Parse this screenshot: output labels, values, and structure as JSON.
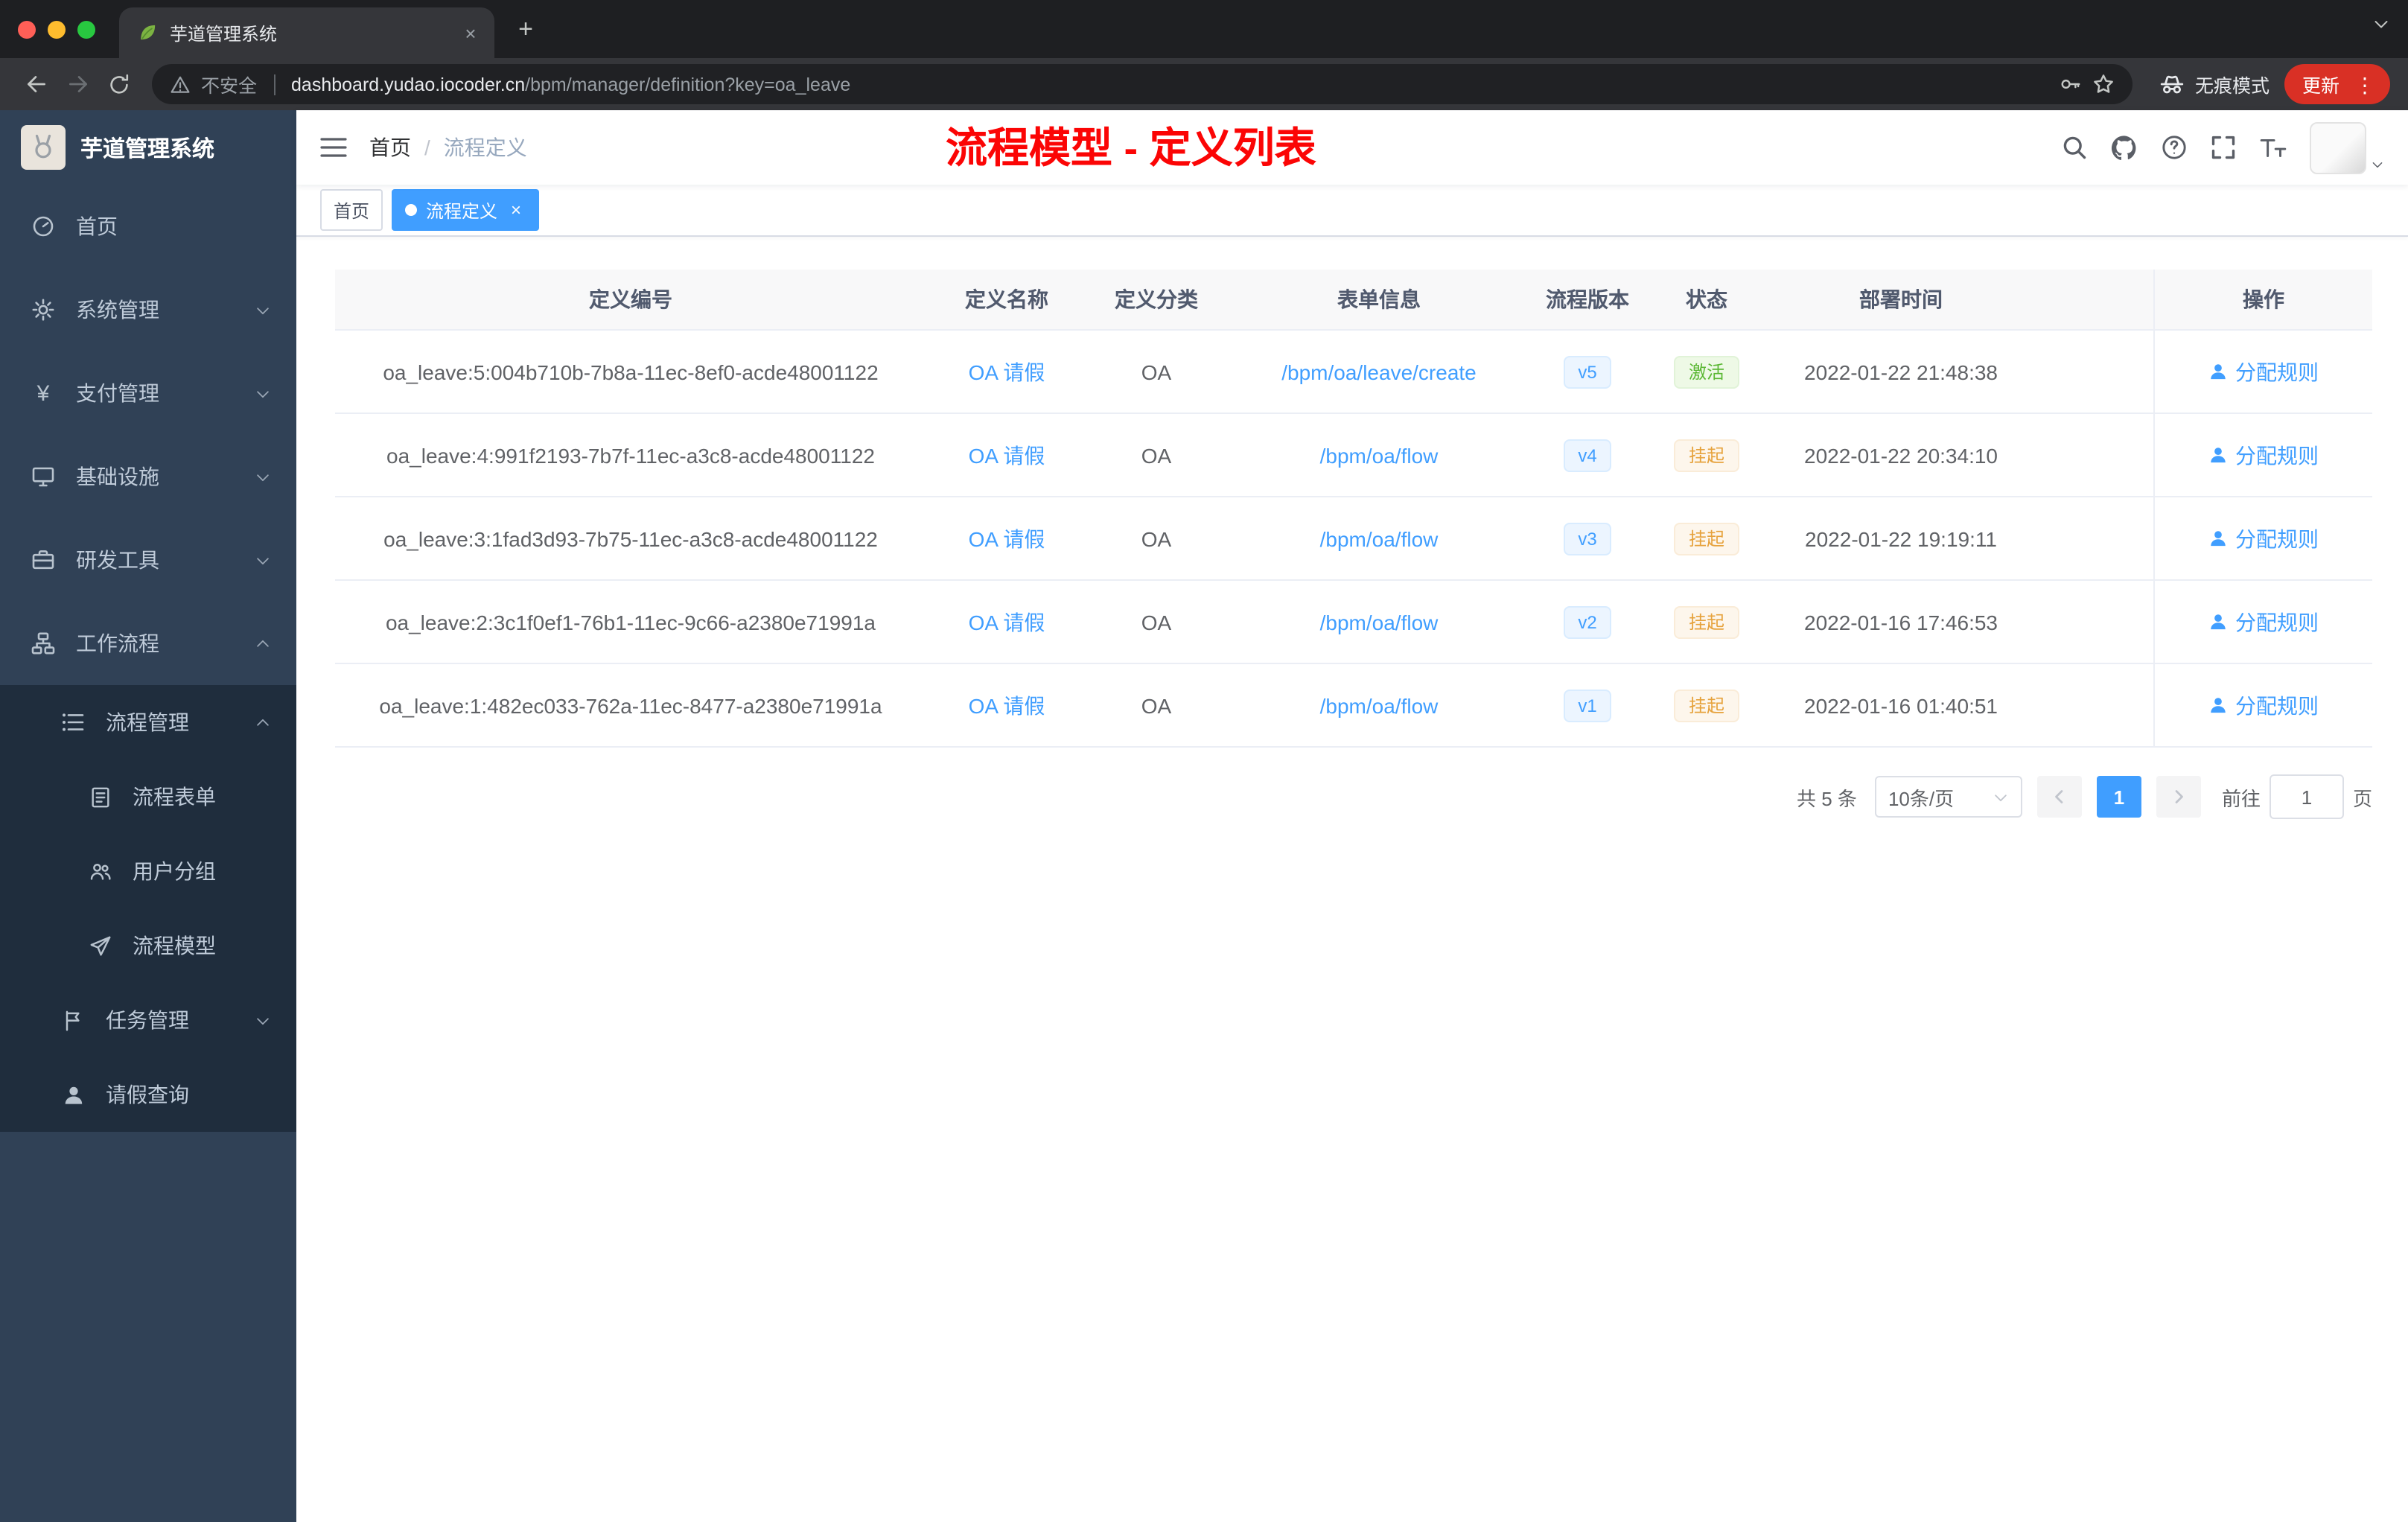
{
  "browser": {
    "tab": {
      "title": "芋道管理系统"
    },
    "address": {
      "security_label": "不安全",
      "url_host": "dashboard.yudao.iocoder.cn",
      "url_path": "/bpm/manager/definition?key=oa_leave"
    },
    "incognito_label": "无痕模式",
    "update_label": "更新"
  },
  "sidebar": {
    "app_title": "芋道管理系统",
    "items": {
      "home": "首页",
      "system": "系统管理",
      "payment": "支付管理",
      "infra": "基础设施",
      "devtools": "研发工具",
      "workflow": "工作流程",
      "process_mgmt": "流程管理",
      "process_form": "流程表单",
      "user_group": "用户分组",
      "process_model": "流程模型",
      "task_mgmt": "任务管理",
      "leave_query": "请假查询"
    }
  },
  "header": {
    "breadcrumb": {
      "home": "首页",
      "separator": "/",
      "current": "流程定义"
    },
    "annotation": "流程模型 - 定义列表"
  },
  "tags": {
    "home": "首页",
    "active": "流程定义"
  },
  "table": {
    "columns": [
      "定义编号",
      "定义名称",
      "定义分类",
      "表单信息",
      "流程版本",
      "状态",
      "部署时间",
      "操作"
    ],
    "rows": [
      {
        "id": "oa_leave:5:004b710b-7b8a-11ec-8ef0-acde48001122",
        "name": "OA 请假",
        "category": "OA",
        "form": "/bpm/oa/leave/create",
        "version": "v5",
        "status": "激活",
        "time": "2022-01-22 21:48:38",
        "action": "分配规则"
      },
      {
        "id": "oa_leave:4:991f2193-7b7f-11ec-a3c8-acde48001122",
        "name": "OA 请假",
        "category": "OA",
        "form": "/bpm/oa/flow",
        "version": "v4",
        "status": "挂起",
        "time": "2022-01-22 20:34:10",
        "action": "分配规则"
      },
      {
        "id": "oa_leave:3:1fad3d93-7b75-11ec-a3c8-acde48001122",
        "name": "OA 请假",
        "category": "OA",
        "form": "/bpm/oa/flow",
        "version": "v3",
        "status": "挂起",
        "time": "2022-01-22 19:19:11",
        "action": "分配规则"
      },
      {
        "id": "oa_leave:2:3c1f0ef1-76b1-11ec-9c66-a2380e71991a",
        "name": "OA 请假",
        "category": "OA",
        "form": "/bpm/oa/flow",
        "version": "v2",
        "status": "挂起",
        "time": "2022-01-16 17:46:53",
        "action": "分配规则"
      },
      {
        "id": "oa_leave:1:482ec033-762a-11ec-8477-a2380e71991a",
        "name": "OA 请假",
        "category": "OA",
        "form": "/bpm/oa/flow",
        "version": "v1",
        "status": "挂起",
        "time": "2022-01-16 01:40:51",
        "action": "分配规则"
      }
    ]
  },
  "pagination": {
    "total": "共 5 条",
    "page_size": "10条/页",
    "current_page": "1",
    "goto_label": "前往",
    "goto_value": "1",
    "goto_unit": "页"
  },
  "colors": {
    "accent_blue": "#409eff",
    "success_green": "#67c23a",
    "warning_orange": "#e6a23c",
    "annotation_red": "#ff0000",
    "sidebar_bg": "#304156",
    "submenu_bg": "#1f2d3d"
  },
  "icon_names": [
    "leaf-favicon-icon",
    "close-icon",
    "plus-icon",
    "chevron-down-icon",
    "back-arrow-icon",
    "forward-arrow-icon",
    "reload-icon",
    "warning-icon",
    "key-icon",
    "star-icon",
    "incognito-icon",
    "more-vert-icon",
    "hamburger-icon",
    "search-icon",
    "github-icon",
    "question-icon",
    "fullscreen-icon",
    "font-size-icon",
    "dashboard-icon",
    "gear-icon",
    "yen-icon",
    "monitor-icon",
    "toolbox-icon",
    "sitemap-icon",
    "list-icon",
    "form-icon",
    "group-icon",
    "paper-plane-icon",
    "flag-icon",
    "user-icon"
  ]
}
